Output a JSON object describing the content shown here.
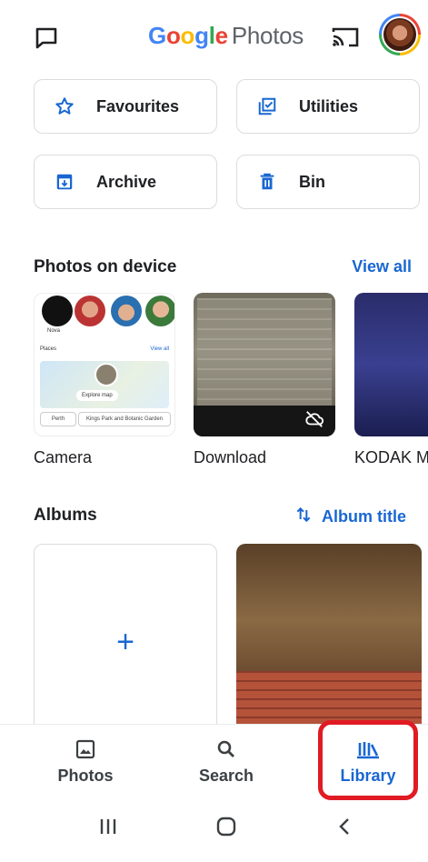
{
  "header": {
    "logo_google": [
      "G",
      "o",
      "o",
      "g",
      "l",
      "e"
    ],
    "logo_colors": [
      "#4285f4",
      "#ea4335",
      "#fbbc05",
      "#4285f4",
      "#34a853",
      "#ea4335"
    ],
    "logo_product": "Photos"
  },
  "utilities": [
    {
      "label": "Favourites",
      "icon": "star-icon"
    },
    {
      "label": "Utilities",
      "icon": "checklist-icon"
    },
    {
      "label": "Archive",
      "icon": "archive-icon"
    },
    {
      "label": "Bin",
      "icon": "trash-icon"
    }
  ],
  "device": {
    "title": "Photos on device",
    "view_all": "View all",
    "folders": [
      {
        "label": "Camera"
      },
      {
        "label": "Download"
      },
      {
        "label": "KODAK M"
      }
    ],
    "camera_thumb": {
      "person_label": "Nova",
      "places": "Places",
      "view_all": "View all",
      "explore": "Explore map",
      "place_1": "Perth",
      "place_2": "Kings Park and Botanic Garden"
    }
  },
  "albums": {
    "title": "Albums",
    "sort_label": "Album title",
    "new_album": "+"
  },
  "bottom_nav": [
    {
      "label": "Photos",
      "icon": "photo-icon",
      "active": false
    },
    {
      "label": "Search",
      "icon": "search-icon",
      "active": false
    },
    {
      "label": "Library",
      "icon": "library-icon",
      "active": true
    }
  ],
  "colors": {
    "accent": "#1967d2",
    "highlight": "#e01b24"
  }
}
